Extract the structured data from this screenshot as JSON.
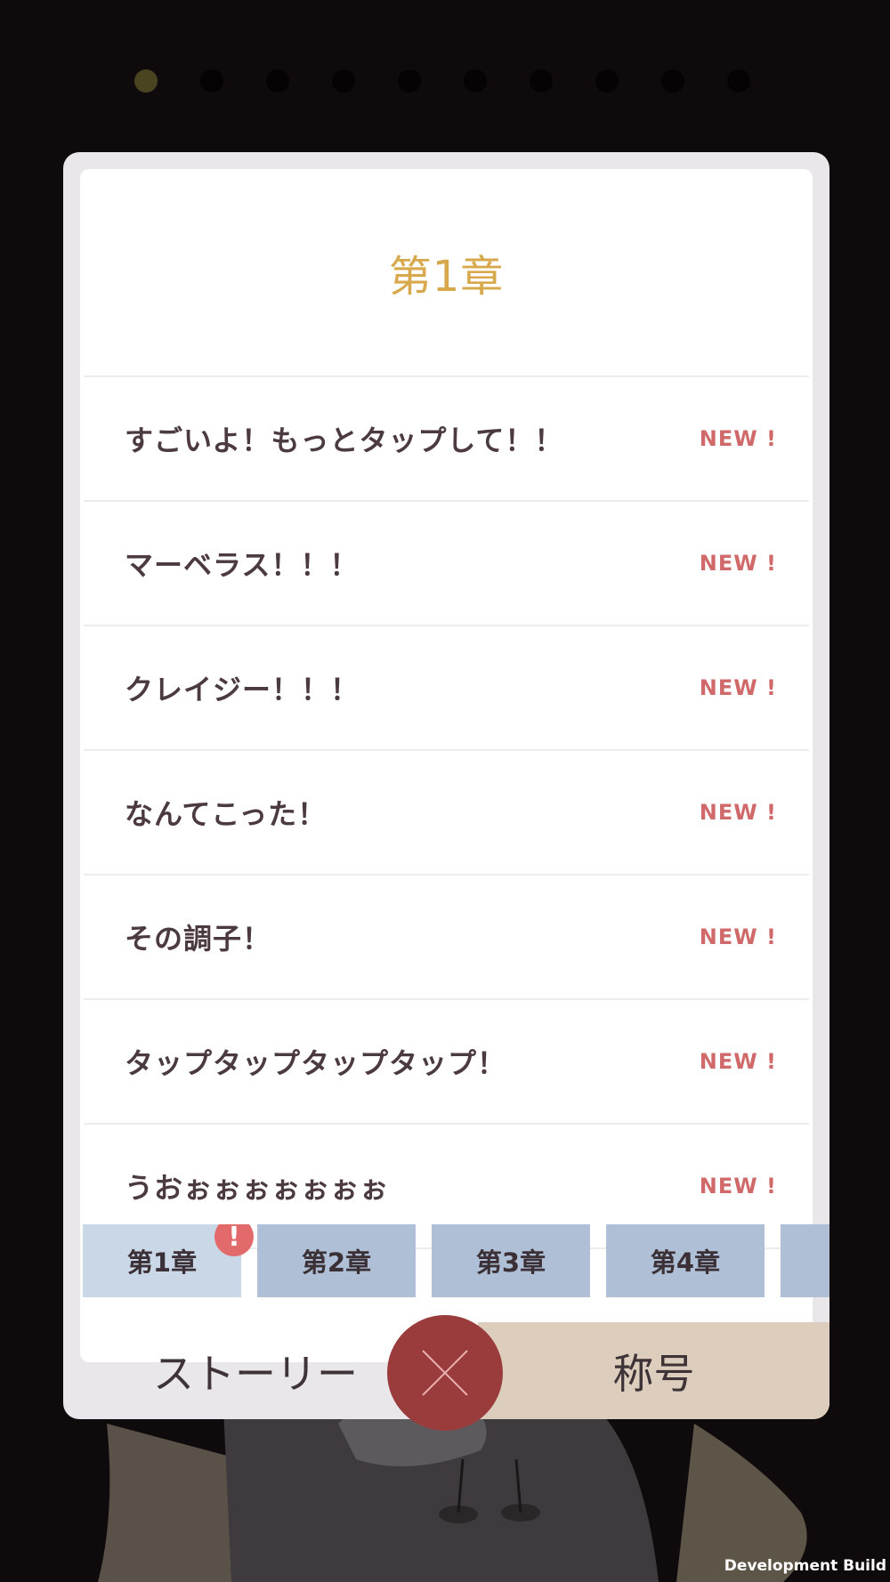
{
  "pager": {
    "count": 10,
    "active_index": 0
  },
  "chapter": {
    "title": "第1章"
  },
  "achievements": [
    {
      "label": "すごいよ！もっとタップして！！",
      "badge": "NEW !"
    },
    {
      "label": "マーベラス！！！",
      "badge": "NEW !"
    },
    {
      "label": "クレイジー！！！",
      "badge": "NEW !"
    },
    {
      "label": "なんてこった！",
      "badge": "NEW !"
    },
    {
      "label": "その調子！",
      "badge": "NEW !"
    },
    {
      "label": "タップタップタップタップ！",
      "badge": "NEW !"
    },
    {
      "label": "うおぉぉぉぉぉぉぉ",
      "badge": "NEW !"
    }
  ],
  "tabs": [
    {
      "label": "第1章",
      "alert": "!"
    },
    {
      "label": "第2章"
    },
    {
      "label": "第3章"
    },
    {
      "label": "第4章"
    },
    {
      "label": ""
    }
  ],
  "bottom": {
    "story_label": "ストーリー",
    "title_label": "称号"
  },
  "footer": {
    "build_label": "Development Build"
  },
  "colors": {
    "accent_gold": "#d8a94c",
    "new_red": "#d06a6a",
    "close_red": "#9b3c3c"
  }
}
